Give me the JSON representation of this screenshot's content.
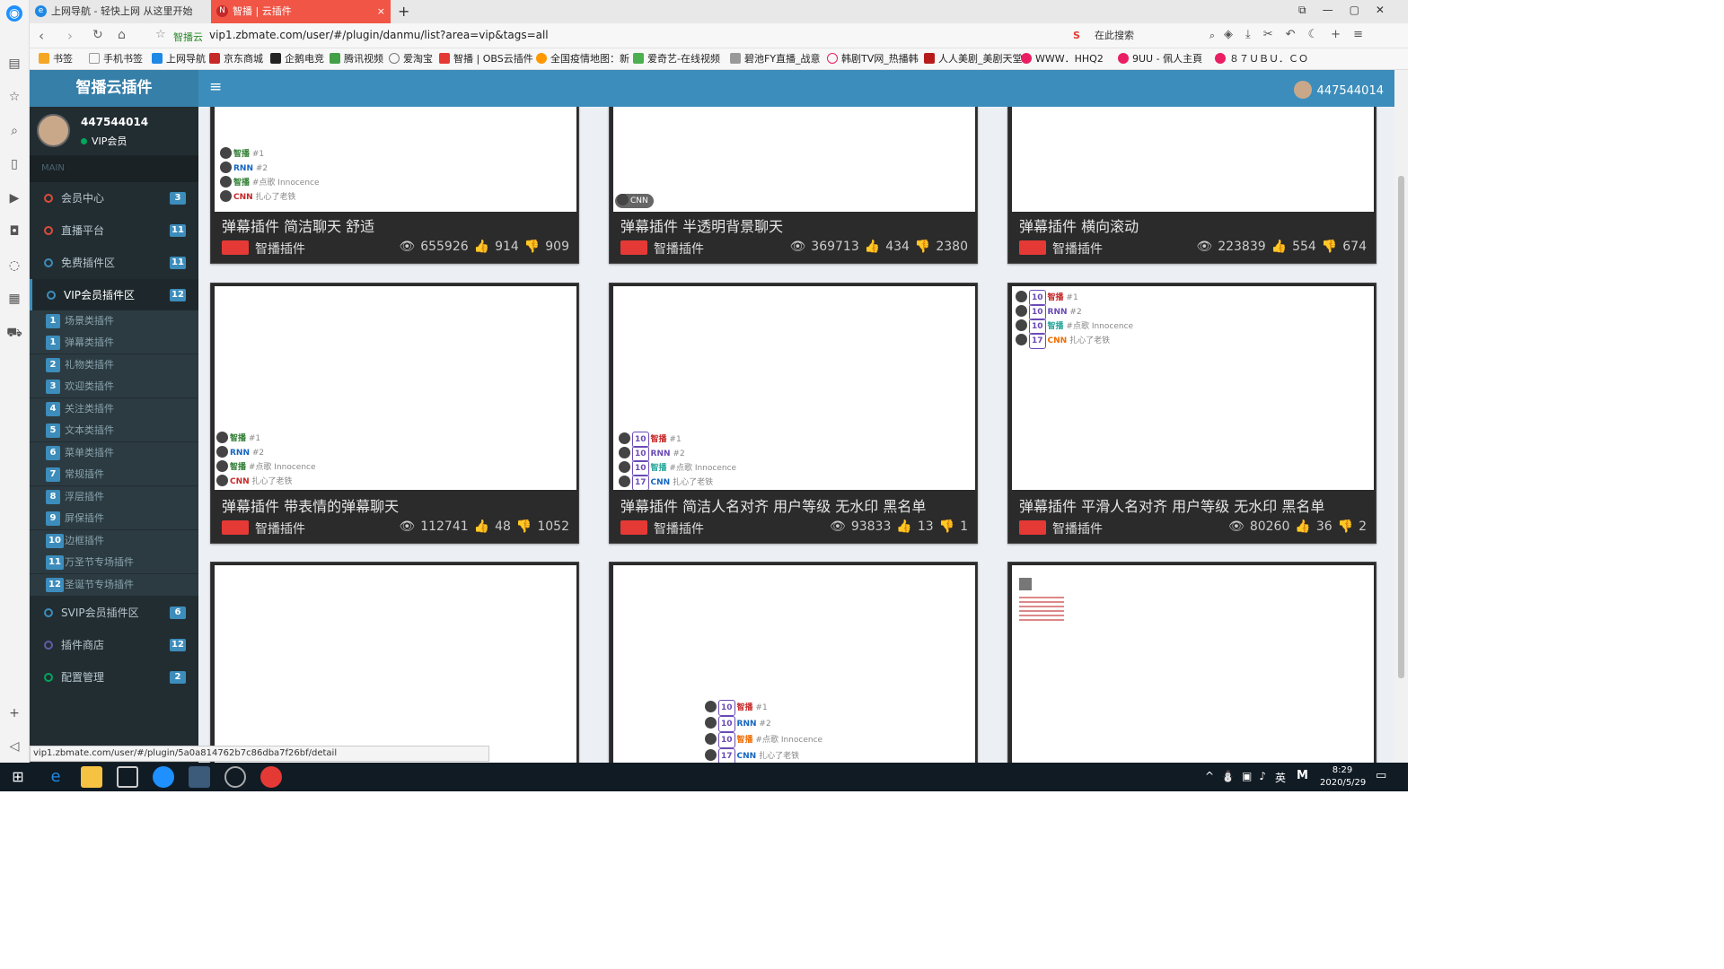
{
  "browser": {
    "tabs": [
      {
        "title": "上网导航 - 轻快上网 从这里开始",
        "active": false
      },
      {
        "title": "智播 | 云插件",
        "active": true
      }
    ],
    "site_badge": "智播云",
    "url": "vip1.zbmate.com/user/#/plugin/danmu/list?area=vip&tags=all",
    "search_placeholder": "在此搜索",
    "bookmarks": [
      "书签",
      "手机书签",
      "上网导航",
      "京东商城",
      "企鹅电竞",
      "腾讯视频",
      "爱淘宝",
      "智播 | OBS云插件",
      "全国疫情地图：新",
      "爱奇艺-在线视频",
      "碧池FY直播_战意",
      "韩剧TV网_热播韩",
      "人人美剧_美剧天堂",
      "WWW．HHQ2",
      "9UU - 佩人主頁",
      "８７ＵＢＵ．ＣＯ"
    ],
    "status_url": "vip1.zbmate.com/user/#/plugin/5a0a814762b7c86dba7f26bf/detail"
  },
  "app": {
    "brand": "智播云插件",
    "user": {
      "name": "447544014",
      "level": "VIP会员"
    },
    "section_label": "MAIN",
    "menu": [
      {
        "label": "会员中心",
        "badge": "3",
        "color": "#dd4b39"
      },
      {
        "label": "直播平台",
        "badge": "11",
        "color": "#dd4b39"
      },
      {
        "label": "免费插件区",
        "badge": "11",
        "color": "#3c8dbc"
      },
      {
        "label": "VIP会员插件区",
        "badge": "12",
        "color": "#3c8dbc"
      }
    ],
    "submenu": [
      {
        "num": "1",
        "label": "场景类插件"
      },
      {
        "num": "1",
        "label": "弹幕类插件"
      },
      {
        "num": "2",
        "label": "礼物类插件"
      },
      {
        "num": "3",
        "label": "欢迎类插件"
      },
      {
        "num": "4",
        "label": "关注类插件"
      },
      {
        "num": "5",
        "label": "文本类插件"
      },
      {
        "num": "6",
        "label": "菜单类插件"
      },
      {
        "num": "7",
        "label": "常规插件"
      },
      {
        "num": "8",
        "label": "浮层插件"
      },
      {
        "num": "9",
        "label": "屏保插件"
      },
      {
        "num": "10",
        "label": "边框插件"
      },
      {
        "num": "11",
        "label": "万圣节专场插件"
      },
      {
        "num": "12",
        "label": "圣诞节专场插件"
      }
    ],
    "menu2": [
      {
        "label": "SVIP会员插件区",
        "badge": "6",
        "color": "#3c8dbc"
      },
      {
        "label": "插件商店",
        "badge": "12",
        "color": "#605ca8"
      },
      {
        "label": "配置管理",
        "badge": "2",
        "color": "#00a65a"
      }
    ]
  },
  "cards": [
    {
      "title": "弹幕插件  简洁聊天  舒适",
      "author": "智播插件",
      "views": "655926",
      "likes": "914",
      "dislikes": "909"
    },
    {
      "title": "弹幕插件  半透明背景聊天",
      "author": "智播插件",
      "views": "369713",
      "likes": "434",
      "dislikes": "2380"
    },
    {
      "title": "弹幕插件  横向滚动",
      "author": "智播插件",
      "views": "223839",
      "likes": "554",
      "dislikes": "674"
    },
    {
      "title": "弹幕插件  带表情的弹幕聊天",
      "author": "智播插件",
      "views": "112741",
      "likes": "48",
      "dislikes": "1052"
    },
    {
      "title": "弹幕插件  简洁人名对齐  用户等级  无水印  黑名单",
      "author": "智播插件",
      "views": "93833",
      "likes": "13",
      "dislikes": "1"
    },
    {
      "title": "弹幕插件  平滑人名对齐  用户等级  无水印  黑名单",
      "author": "智播插件",
      "views": "80260",
      "likes": "36",
      "dislikes": "2"
    }
  ],
  "preview_lines": {
    "names": [
      "智播",
      "RNN",
      "智播",
      "CNN"
    ],
    "msgs": [
      "#1",
      "#2",
      "#点歌 Innocence",
      "扎心了老铁"
    ],
    "levels": [
      "10",
      "10",
      "10",
      "17"
    ]
  },
  "taskbar": {
    "time": "8:29",
    "date": "2020/5/29",
    "ime": "英"
  }
}
